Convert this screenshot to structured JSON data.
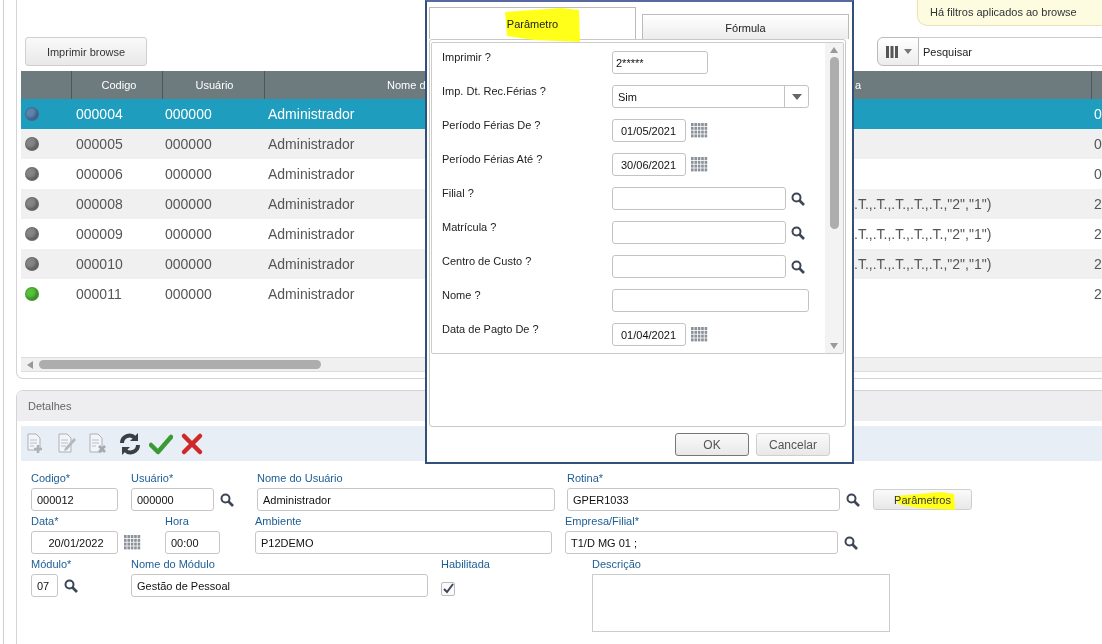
{
  "browse": {
    "print_button": "Imprimir browse",
    "filter_notice": "Há filtros aplicados ao browse",
    "search": {
      "placeholder": "Pesquisar"
    },
    "table": {
      "columns": [
        "Codigo",
        "Usuário",
        "Nome d",
        "a"
      ],
      "rows": [
        {
          "selected": true,
          "color": "#5b84b1",
          "codigo": "000004",
          "usuario": "000000",
          "nome": "Administrador",
          "column_6": "0"
        },
        {
          "selected": false,
          "color": "#858585",
          "codigo": "000005",
          "usuario": "000000",
          "nome": "Administrador",
          "column_6": "0"
        },
        {
          "selected": false,
          "color": "#858585",
          "codigo": "000006",
          "usuario": "000000",
          "nome": "Administrador",
          "column_6": "0"
        },
        {
          "selected": false,
          "color": "#858585",
          "codigo": "000008",
          "usuario": "000000",
          "nome": "Administrador",
          "column_5": ".T.,.T.,.T.,.T.,.T.,\"2\",\"1\")",
          "column_6": "2"
        },
        {
          "selected": false,
          "color": "#858585",
          "codigo": "000009",
          "usuario": "000000",
          "nome": "Administrador",
          "column_5": ".T.,.T.,.T.,.T.,.T.,\"2\",\"1\")",
          "column_6": "2"
        },
        {
          "selected": false,
          "color": "#858585",
          "codigo": "000010",
          "usuario": "000000",
          "nome": "Administrador",
          "column_5": ".T.,.T.,.T.,.T.,.T.,\"2\",\"1\")",
          "column_6": "2"
        },
        {
          "selected": false,
          "color": "#55c23a",
          "codigo": "000011",
          "usuario": "000000",
          "nome": "Administrador",
          "column_6": "2"
        }
      ]
    }
  },
  "details": {
    "title": "Detalhes",
    "toolbar": [
      {
        "kind": "new",
        "disabled": true
      },
      {
        "kind": "edit",
        "disabled": true
      },
      {
        "kind": "delete",
        "disabled": true
      },
      {
        "kind": "refresh",
        "disabled": false
      },
      {
        "kind": "confirm",
        "disabled": false
      },
      {
        "kind": "cancel",
        "disabled": false
      }
    ],
    "rows": [
      [
        {
          "kind": "text",
          "label": "Codigo*",
          "value": "000012"
        },
        {
          "kind": "lookup",
          "label": "Usuário*",
          "value": "000000"
        },
        {
          "kind": "text",
          "label": "Nome do Usuário",
          "value": "Administrador"
        },
        {
          "kind": "lookup",
          "label": "Rotina*",
          "value": "GPER1033"
        },
        {
          "kind": "button",
          "label": "Parâmetros",
          "highlighted": true
        }
      ],
      [
        {
          "kind": "date",
          "label": "Data*",
          "value": "20/01/2022"
        },
        {
          "kind": "text",
          "label": "Hora",
          "value": "00:00"
        },
        {
          "kind": "text",
          "label": "Ambiente",
          "value": "P12DEMO"
        },
        {
          "kind": "lookup",
          "label": "Empresa/Filial*",
          "value": "T1/D MG 01 ;"
        }
      ],
      [
        {
          "kind": "lookup",
          "label": "Módulo*",
          "value": "07"
        },
        {
          "kind": "text",
          "label": "Nome do Módulo",
          "value": "Gestão de Pessoal"
        },
        {
          "kind": "checkbox",
          "label": "Habilitada",
          "checked": true
        },
        {
          "kind": "textarea",
          "label": "Descrição"
        }
      ]
    ]
  },
  "dialog": {
    "tabs": [
      {
        "label": "Parâmetro",
        "selected": true,
        "highlighted": true
      },
      {
        "label": "Fórmula",
        "selected": false,
        "highlighted": false
      }
    ],
    "params": [
      {
        "kind": "text",
        "label": "Imprimir ?",
        "value": "2*****"
      },
      {
        "kind": "select",
        "label": "Imp. Dt. Rec.Férias ?",
        "value": "Sim"
      },
      {
        "kind": "date",
        "label": "Período Férias De ?",
        "value": "01/05/2021"
      },
      {
        "kind": "date",
        "label": "Período Férias Até ?",
        "value": "30/06/2021"
      },
      {
        "kind": "lookup",
        "label": "Filial ?"
      },
      {
        "kind": "lookup",
        "label": "Matrícula ?"
      },
      {
        "kind": "lookup",
        "label": "Centro de Custo ?"
      },
      {
        "kind": "text",
        "label": "Nome ?"
      },
      {
        "kind": "date",
        "label": "Data de Pagto De ?",
        "value": "01/04/2021"
      }
    ],
    "buttons": [
      {
        "label": "OK",
        "default": true
      },
      {
        "label": "Cancelar",
        "default": false
      }
    ]
  }
}
